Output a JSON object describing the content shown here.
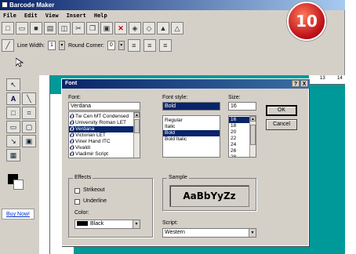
{
  "window": {
    "title": "Barcode Maker",
    "menu": [
      "File",
      "Edit",
      "View",
      "Insert",
      "Help"
    ]
  },
  "toolbar": {
    "line_width_label": "Line Width:",
    "line_width_value": "1",
    "round_corner_label": "Round Corner:",
    "round_corner_value": "0"
  },
  "badge": {
    "number": "10"
  },
  "side": {
    "buy_now": "Buy Now!"
  },
  "ruler": {
    "ticks": [
      "13",
      "14"
    ]
  },
  "dialog": {
    "title": "Font",
    "title_buttons": [
      "?",
      "X"
    ],
    "font_label": "Font:",
    "font_value": "Verdana",
    "fonts": [
      "Tw Cen MT Condensed",
      "University Roman LET",
      "Verdana",
      "Victorian LET",
      "Viner Hand ITC",
      "Vivaldi",
      "Vladimir Script"
    ],
    "font_selected": 2,
    "style_label": "Font style:",
    "style_value": "Bold",
    "styles": [
      "Regular",
      "Italic",
      "Bold",
      "Bold Italic"
    ],
    "style_selected": 2,
    "size_label": "Size:",
    "size_value": "16",
    "sizes": [
      "16",
      "18",
      "20",
      "22",
      "24",
      "26",
      "28"
    ],
    "size_selected": 0,
    "ok": "OK",
    "cancel": "Cancel",
    "effects_label": "Effects",
    "strikeout": "Strikeout",
    "underline": "Underline",
    "color_label": "Color:",
    "color_value": "Black",
    "color_hex": "#000000",
    "sample_label": "Sample",
    "sample_text": "AaBbYyZz",
    "script_label": "Script:",
    "script_value": "Western"
  }
}
